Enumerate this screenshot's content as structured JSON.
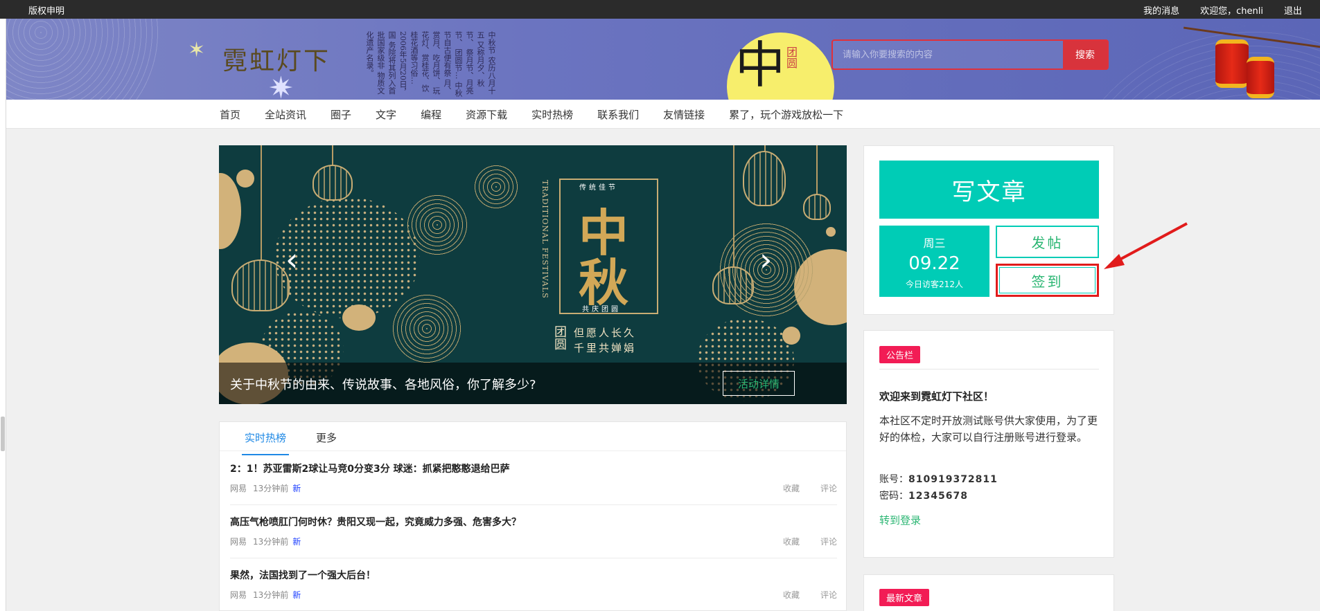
{
  "topbar": {
    "copyright": "版权申明",
    "messages": "我的消息",
    "welcome": "欢迎您，chenli",
    "logout": "退出"
  },
  "header": {
    "logo_text": "霓虹灯下",
    "poem": "中秋节 农历八月十五 又称月夕、秋节、 祭月节、月亮节、 团圆节… 中秋节自古便有祭 月、赏月、吃月饼、 玩花灯、赏桂花、饮 桂花酒等习俗… 2006年5月20日，国 务院将其列入首批国家级非 物质文化遗产名录。",
    "moon_char": "中",
    "moon_char2": "团圆",
    "search_placeholder": "请输入你要搜索的内容",
    "search_button": "搜索"
  },
  "nav": {
    "items": [
      "首页",
      "全站资讯",
      "圈子",
      "文字",
      "编程",
      "资源下载",
      "实时热榜",
      "联系我们",
      "友情链接",
      "累了，玩个游戏放松一下"
    ]
  },
  "carousel": {
    "top_small": "传统佳节",
    "char1": "中",
    "char2": "秋",
    "bottom_small": "共庆团圆",
    "side_en": "TRADITIONAL FESTIVALS",
    "tuanyuan": "团圆",
    "motto1": "但愿人长久",
    "motto2": "千里共婵娟",
    "prev": "‹",
    "next": "›",
    "caption": "关于中秋节的由来、传说故事、各地风俗，你了解多少?",
    "detail_button": "活动详情"
  },
  "hot": {
    "tab_active": "实时热榜",
    "tab_more": "更多",
    "items": [
      {
        "title": "2：1！苏亚雷斯2球让马竞0分变3分 球迷：抓紧把憨憨退给巴萨",
        "source": "网易",
        "time": "13分钟前",
        "badge": "新",
        "collect": "收藏",
        "comment": "评论"
      },
      {
        "title": "高压气枪喷肛门何时休？贵阳又现一起，究竟威力多强、危害多大？",
        "source": "网易",
        "time": "13分钟前",
        "badge": "新",
        "collect": "收藏",
        "comment": "评论"
      },
      {
        "title": "果然，法国找到了一个强大后台！",
        "source": "网易",
        "time": "13分钟前",
        "badge": "新",
        "collect": "收藏",
        "comment": "评论"
      }
    ]
  },
  "sidebar": {
    "write_button": "写文章",
    "weekday": "周三",
    "date": "09.22",
    "visitors": "今日访客212人",
    "post_button": "发帖",
    "sign_button": "签到"
  },
  "notice": {
    "tag": "公告栏",
    "welcome": "欢迎来到霓虹灯下社区！",
    "desc": "本社区不定时开放测试账号供大家使用，为了更好的体检，大家可以自行注册账号进行登录。",
    "account_label": "账号：",
    "account": "810919372811",
    "password_label": "密码：",
    "password": "12345678",
    "login_link": "转到登录"
  },
  "latest": {
    "tag": "最新文章"
  },
  "colors": {
    "teal": "#00ccb6",
    "red_tag": "#f21c55",
    "search_red": "#d8333c",
    "annotation_red": "#e11b1b"
  }
}
